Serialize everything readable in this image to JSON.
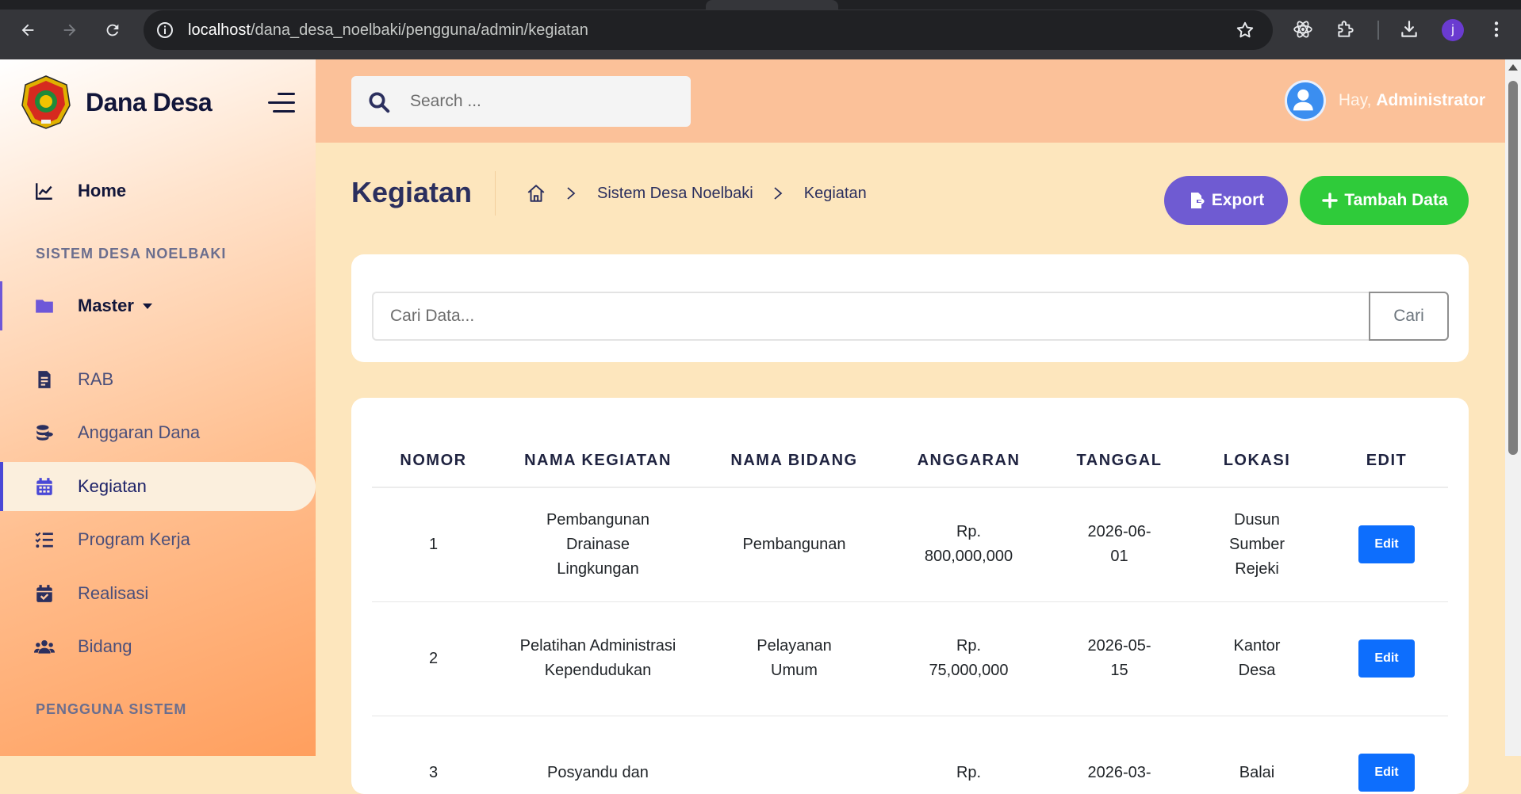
{
  "browser": {
    "url_host": "localhost",
    "url_path": "/dana_desa_noelbaki/pengguna/admin/kegiatan",
    "profile_initial": "j"
  },
  "sidebar": {
    "brand": "Dana Desa",
    "home_label": "Home",
    "section1": "SISTEM DESA NOELBAKI",
    "master_label": "Master",
    "items": [
      {
        "label": "RAB",
        "icon": "file-invoice-icon"
      },
      {
        "label": "Anggaran Dana",
        "icon": "coins-icon"
      },
      {
        "label": "Kegiatan",
        "icon": "calendar-icon"
      },
      {
        "label": "Program Kerja",
        "icon": "list-check-icon"
      },
      {
        "label": "Realisasi",
        "icon": "calendar-check-icon"
      },
      {
        "label": "Bidang",
        "icon": "users-icon"
      }
    ],
    "section2": "PENGGUNA SISTEM"
  },
  "topbar": {
    "search_placeholder": "Search ...",
    "greeting_prefix": "Hay, ",
    "user_name": "Administrator"
  },
  "page": {
    "title": "Kegiatan",
    "breadcrumb": [
      "Sistem Desa Noelbaki",
      "Kegiatan"
    ],
    "export_label": "Export",
    "add_label": "Tambah Data",
    "search_placeholder": "Cari Data...",
    "search_button": "Cari"
  },
  "table": {
    "headers": [
      "NOMOR",
      "NAMA KEGIATAN",
      "NAMA BIDANG",
      "ANGGARAN",
      "TANGGAL",
      "LOKASI",
      "EDIT"
    ],
    "rows": [
      {
        "nomor": "1",
        "nama": "Pembangunan Drainase Lingkungan",
        "bidang": "Pembangunan",
        "anggaran": "Rp. 800,000,000",
        "tanggal": "2026-06-01",
        "lokasi": "Dusun Sumber Rejeki",
        "edit": "Edit"
      },
      {
        "nomor": "2",
        "nama": "Pelatihan Administrasi Kependudukan",
        "bidang": "Pelayanan Umum",
        "anggaran": "Rp. 75,000,000",
        "tanggal": "2026-05-15",
        "lokasi": "Kantor Desa",
        "edit": "Edit"
      },
      {
        "nomor": "3",
        "nama": "Posyandu dan",
        "bidang": "",
        "anggaran": "Rp.",
        "tanggal": "2026-03-",
        "lokasi": "Balai",
        "edit": "Edit"
      }
    ]
  },
  "colors": {
    "accent_purple": "#6f5bd2",
    "accent_green": "#2fcb3a",
    "edit_blue": "#0d6efd",
    "topbar": "#fbc199",
    "content_bg": "#fde6bd"
  }
}
